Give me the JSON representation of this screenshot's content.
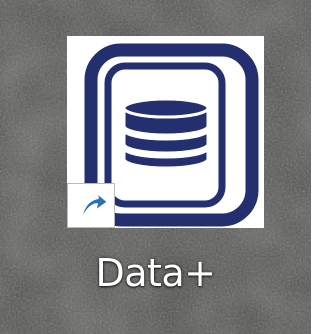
{
  "desktop": {
    "background_color": "#4d4d4b"
  },
  "shortcut": {
    "label": "Data+",
    "icon": "database-icon",
    "overlay_icon": "shortcut-arrow-icon",
    "brand_color": "#232f6e",
    "overlay_color": "#2c6fb5"
  }
}
